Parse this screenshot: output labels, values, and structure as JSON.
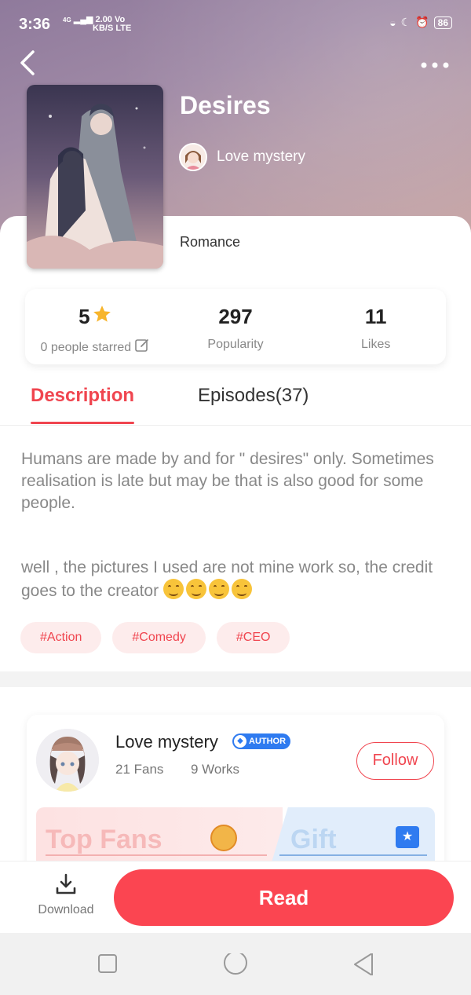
{
  "status_bar": {
    "time": "3:36",
    "network_top": "4G",
    "speed": "2.00",
    "speed_unit": "KB/S",
    "carrier_top": "Vo",
    "carrier_bottom": "LTE",
    "battery": "86"
  },
  "book": {
    "title": "Desires",
    "author": "Love mystery",
    "genre": "Romance"
  },
  "stats": {
    "rating": "5",
    "rating_label": "0 people starred",
    "popularity": "297",
    "popularity_label": "Popularity",
    "likes": "11",
    "likes_label": "Likes"
  },
  "tabs": {
    "description": "Description",
    "episodes": "Episodes(37)"
  },
  "description": {
    "paragraph1": "Humans are made by and for \" desires\" only. Sometimes realisation is late but may be that is also good for some people.",
    "paragraph2": "well , the pictures I used are not mine work so, the credit goes to the creator "
  },
  "tags": [
    "#Action",
    "#Comedy",
    "#CEO"
  ],
  "author_card": {
    "name": "Love mystery",
    "badge": "AUTHOR",
    "fans": "21 Fans",
    "works": "9 Works",
    "follow": "Follow",
    "top_fans": "Top Fans",
    "gift": "Gift"
  },
  "bottom_bar": {
    "download": "Download",
    "read": "Read"
  },
  "icons": {
    "back": "chevron-left-icon",
    "more": "more-horizontal-icon",
    "star": "star-icon",
    "edit": "edit-icon",
    "download": "download-icon",
    "gift": "gift-icon"
  },
  "colors": {
    "accent": "#f0454f",
    "read_button": "#fb4551",
    "badge_blue": "#2f7bf0"
  }
}
